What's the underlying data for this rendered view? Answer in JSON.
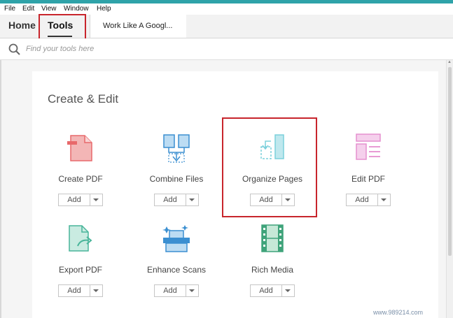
{
  "menu": [
    "File",
    "Edit",
    "View",
    "Window",
    "Help"
  ],
  "tabs": {
    "home": "Home",
    "tools": "Tools",
    "document": "Work Like A Googl..."
  },
  "search": {
    "placeholder": "Find your tools here"
  },
  "section_title": "Create & Edit",
  "tools": [
    {
      "label": "Create PDF",
      "icon": "create-pdf-icon",
      "button": "Add"
    },
    {
      "label": "Combine Files",
      "icon": "combine-files-icon",
      "button": "Add"
    },
    {
      "label": "Organize Pages",
      "icon": "organize-pages-icon",
      "button": "Add"
    },
    {
      "label": "Edit PDF",
      "icon": "edit-pdf-icon",
      "button": "Add"
    },
    {
      "label": "Export PDF",
      "icon": "export-pdf-icon",
      "button": "Add"
    },
    {
      "label": "Enhance Scans",
      "icon": "enhance-scans-icon",
      "button": "Add"
    },
    {
      "label": "Rich Media",
      "icon": "rich-media-icon",
      "button": "Add"
    }
  ],
  "colors": {
    "accent": "#2fa3a9",
    "highlight": "#c8252c",
    "create_red": "#e8696b",
    "combine_blue": "#3b8fd1",
    "organize_teal": "#7bd0dc",
    "edit_pink": "#e590cf",
    "export_green": "#49b59a",
    "media_green": "#3fa37a"
  },
  "watermark": "www.989214.com"
}
